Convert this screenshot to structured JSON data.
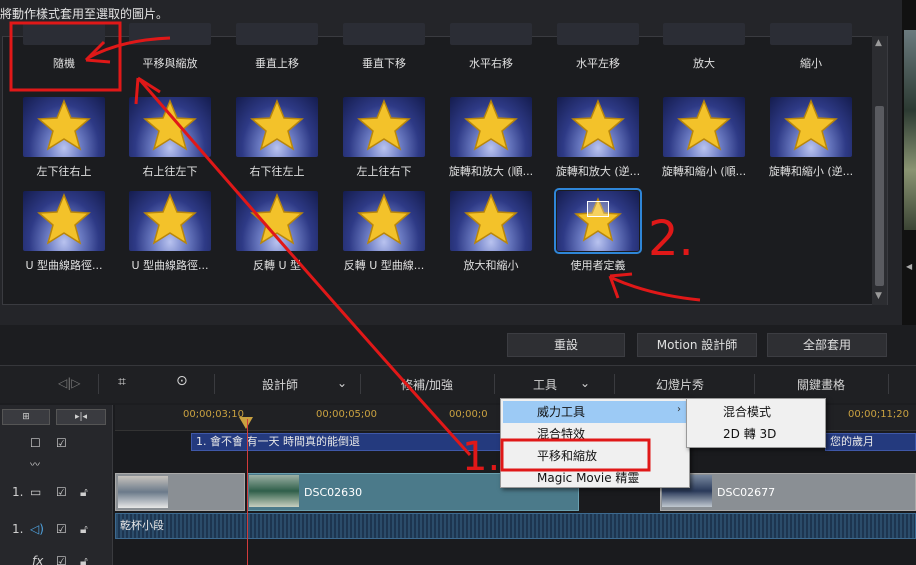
{
  "hint": "將動作樣式套用至選取的圖片。",
  "tiles_row1": [
    {
      "label": "隨機"
    },
    {
      "label": "平移與縮放"
    },
    {
      "label": "垂直上移"
    },
    {
      "label": "垂直下移"
    },
    {
      "label": "水平右移"
    },
    {
      "label": "水平左移"
    },
    {
      "label": "放大"
    },
    {
      "label": "縮小"
    }
  ],
  "tiles_row2": [
    {
      "label": "左下往右上"
    },
    {
      "label": "右上往左下"
    },
    {
      "label": "右下往左上"
    },
    {
      "label": "左上往右下"
    },
    {
      "label": "旋轉和放大 (順..."
    },
    {
      "label": "旋轉和放大 (逆..."
    },
    {
      "label": "旋轉和縮小 (順..."
    },
    {
      "label": "旋轉和縮小 (逆..."
    }
  ],
  "tiles_row3": [
    {
      "label": "U 型曲線路徑..."
    },
    {
      "label": "U 型曲線路徑..."
    },
    {
      "label": "反轉 U 型"
    },
    {
      "label": "反轉 U 型曲線..."
    },
    {
      "label": "放大和縮小"
    },
    {
      "label": "使用者定義"
    }
  ],
  "buttons": {
    "reset": "重設",
    "motion_designer": "Motion 設計師",
    "apply_all": "全部套用"
  },
  "toolbar": {
    "designer": "設計師",
    "fix": "修補/加強",
    "tools": "工具",
    "slideshow": "幻燈片秀",
    "keyframe": "關鍵畫格"
  },
  "ruler": {
    "t1": "00;00;03;10",
    "t2": "00;00;05;00",
    "t3": "00;00;0",
    "t4": "00;00;11;20"
  },
  "tracks": {
    "title_clip": "1. 會不會 有一天 時間真的能倒退",
    "title_clip_right": "您的歲月",
    "track1": "1.",
    "track1b": "1.",
    "clip1": "DSC02630",
    "clip2": "DSC02677",
    "audio_clip": "乾杯小段",
    "fx": "fx"
  },
  "menu": {
    "power_tools": "威力工具",
    "blend": "混合特效",
    "pan_zoom": "平移和縮放",
    "magic_movie": "Magic Movie 精靈"
  },
  "submenu": {
    "blend_mode": "混合模式",
    "to3d": "2D 轉 3D"
  },
  "annotations": {
    "n1": "1.",
    "n2": "2."
  }
}
